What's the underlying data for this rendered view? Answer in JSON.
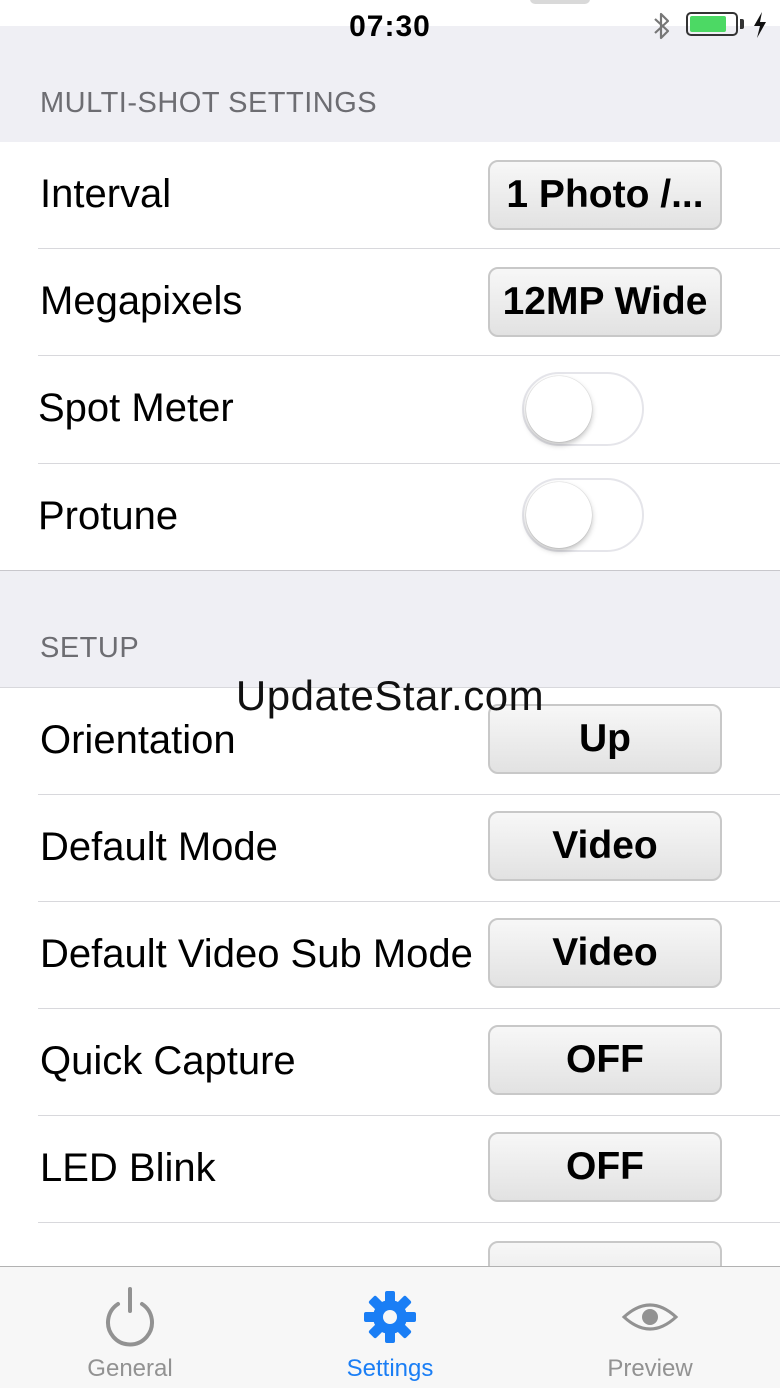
{
  "status_bar": {
    "time": "07:30"
  },
  "sections": [
    {
      "header": "MULTI-SHOT SETTINGS",
      "rows": [
        {
          "label": "Interval",
          "control": "button",
          "value": "1 Photo /..."
        },
        {
          "label": "Megapixels",
          "control": "button",
          "value": "12MP Wide"
        },
        {
          "label": "Spot Meter",
          "control": "toggle",
          "on": false
        },
        {
          "label": "Protune",
          "control": "toggle",
          "on": false
        }
      ]
    },
    {
      "header": "SETUP",
      "rows": [
        {
          "label": "Orientation",
          "control": "button",
          "value": "Up"
        },
        {
          "label": "Default Mode",
          "control": "button",
          "value": "Video"
        },
        {
          "label": "Default Video Sub Mode",
          "control": "button",
          "value": "Video"
        },
        {
          "label": "Quick Capture",
          "control": "button",
          "value": "OFF"
        },
        {
          "label": "LED Blink",
          "control": "button",
          "value": "OFF"
        }
      ]
    }
  ],
  "watermark": "UpdateStar.com",
  "tab_bar": {
    "tabs": [
      {
        "label": "General",
        "icon": "power-icon",
        "active": false
      },
      {
        "label": "Settings",
        "icon": "gear-icon",
        "active": true
      },
      {
        "label": "Preview",
        "icon": "eye-icon",
        "active": false
      }
    ]
  },
  "colors": {
    "accent": "#1a7ef5",
    "toggle_off_border": "#e5e5ea",
    "background": "#efeff4"
  }
}
